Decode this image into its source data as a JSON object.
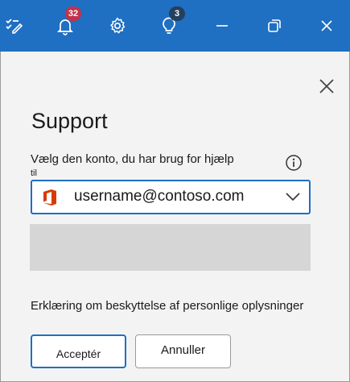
{
  "titlebar": {
    "notifications_count": "32",
    "tips_count": "3",
    "icons": [
      "edit-checklist-icon",
      "bell-icon",
      "gear-icon",
      "lightbulb-icon",
      "minimize-icon",
      "restore-icon",
      "close-icon"
    ]
  },
  "dialog": {
    "title": "Support",
    "prompt_line1": "Vælg den konto, du har brug for hjælp",
    "prompt_line2": "til",
    "account": "username@contoso.com",
    "privacy": "Erklæring om beskyttelse af personlige oplysninger",
    "accept_label": "Acceptér",
    "cancel_label": "Annuller"
  },
  "colors": {
    "titlebar": "#1f6fc2",
    "panel": "#f3f3f3",
    "accent": "#1f6fc2",
    "badge_red": "#c4314b",
    "office_logo": "#d83b01"
  }
}
